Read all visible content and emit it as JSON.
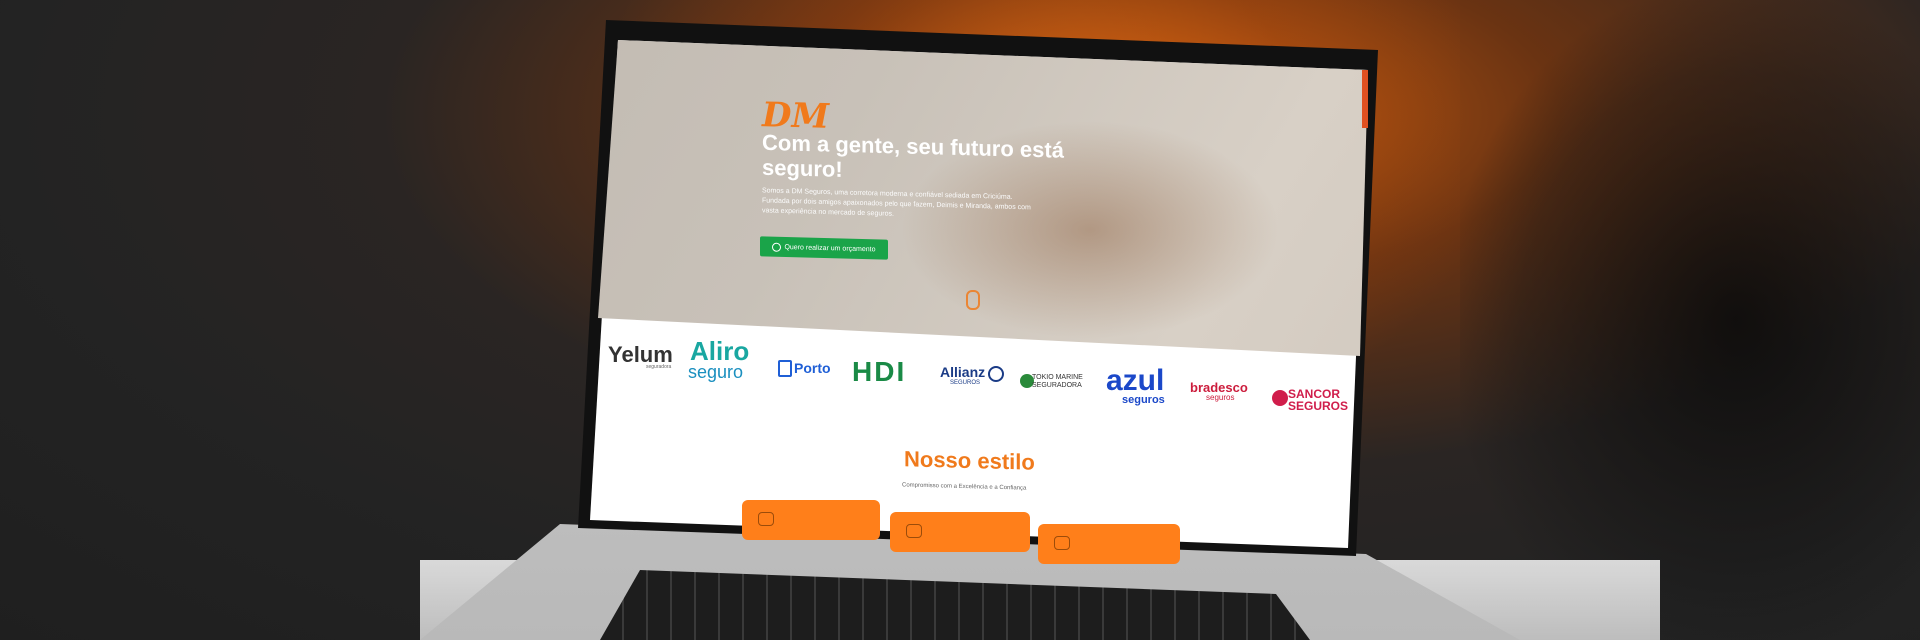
{
  "hero": {
    "logo": "DM",
    "title": "Com a gente, seu futuro está seguro!",
    "description": "Somos a DM Seguros, uma corretora moderna e confiável sediada em Criciúma. Fundada por dois amigos apaixonados pelo que fazem, Deimis e Miranda, ambos com vasta experiência no mercado de seguros.",
    "cta_label": "Quero realizar um orçamento",
    "cta_icon": "whatsapp-icon"
  },
  "partners": {
    "yelum": "Yelum",
    "yelum_sub": "seguradora",
    "aliro": "Aliro",
    "aliro_sub": "seguro",
    "porto": "Porto",
    "hdi": "HDI",
    "allianz": "Allianz",
    "allianz_sub": "SEGUROS",
    "tokio_line1": "TOKIO MARINE",
    "tokio_line2": "SEGURADORA",
    "azul": "azul",
    "azul_sub": "seguros",
    "bradesco": "bradesco",
    "bradesco_sub": "seguros",
    "sancor_line1": "SANCOR",
    "sancor_line2": "SEGUROS"
  },
  "section": {
    "title": "Nosso estilo",
    "subtitle": "Compromisso com a Excelência e a Confiança"
  },
  "colors": {
    "brand_orange": "#f07a1c",
    "cta_green": "#1aa449"
  }
}
